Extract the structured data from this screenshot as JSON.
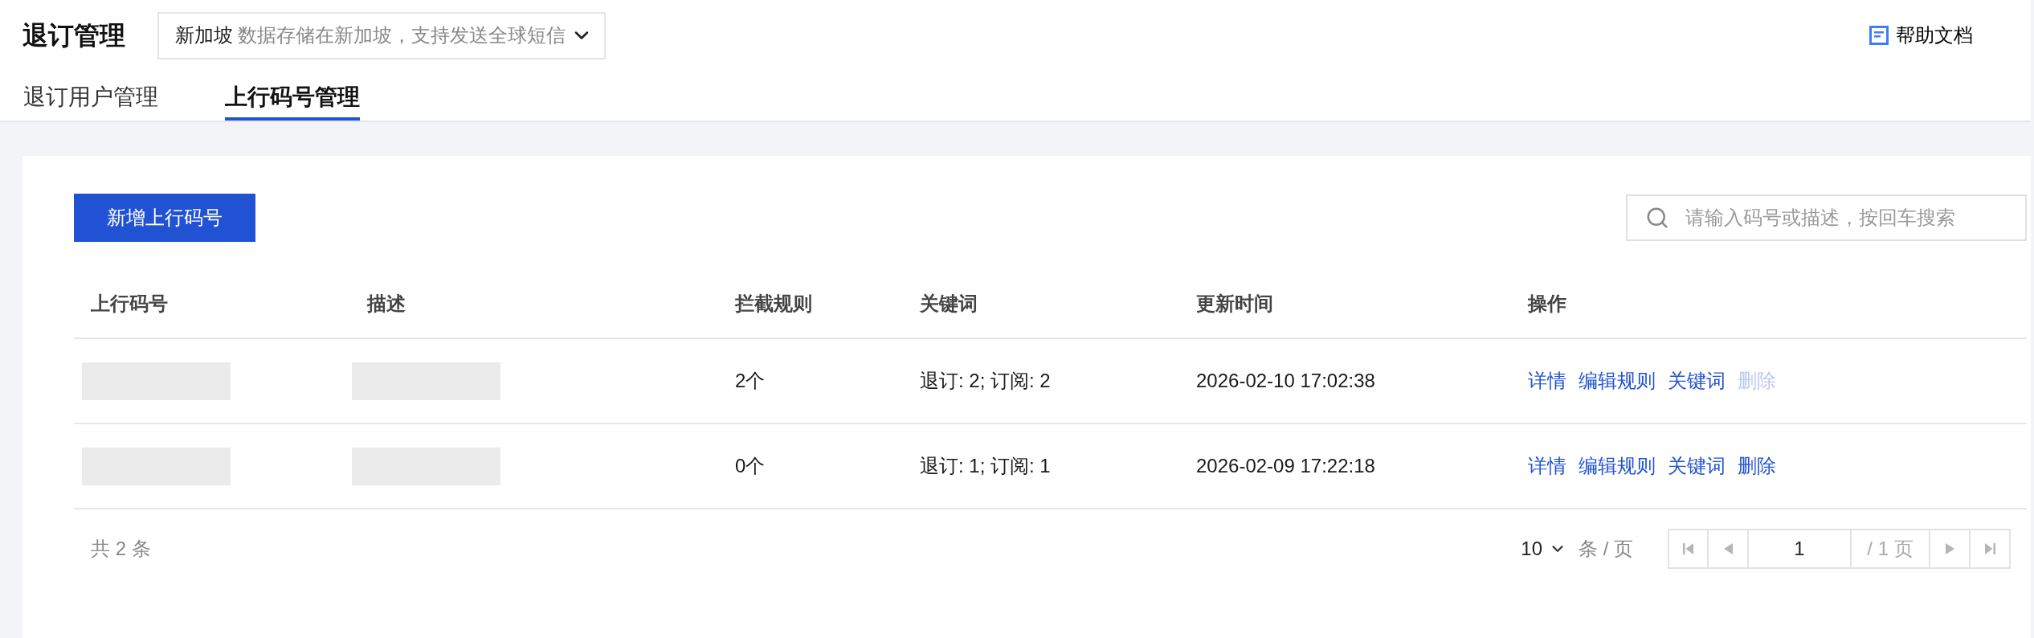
{
  "header": {
    "title": "退订管理",
    "region": {
      "name": "新加坡",
      "note": "数据存储在新加坡，支持发送全球短信"
    },
    "help_link": "帮助文档"
  },
  "tabs": [
    {
      "label": "退订用户管理",
      "selected": false
    },
    {
      "label": "上行码号管理",
      "selected": true
    }
  ],
  "toolbar": {
    "add_button": "新增上行码号",
    "search": {
      "placeholder": "请输入码号或描述，按回车搜索"
    }
  },
  "table": {
    "columns": [
      "上行码号",
      "描述",
      "拦截规则",
      "关键词",
      "更新时间",
      "操作"
    ],
    "rows": [
      {
        "code_redacted": true,
        "description_redacted": true,
        "rules": "2个",
        "keywords": "退订: 2; 订阅: 2",
        "updated": "2026-02-10 17:02:38",
        "actions": [
          {
            "label": "详情",
            "disabled": false
          },
          {
            "label": "编辑规则",
            "disabled": false
          },
          {
            "label": "关键词",
            "disabled": false
          },
          {
            "label": "删除",
            "disabled": true
          }
        ]
      },
      {
        "code_redacted": true,
        "description_redacted": true,
        "rules": "0个",
        "keywords": "退订: 1; 订阅: 1",
        "updated": "2026-02-09 17:22:18",
        "actions": [
          {
            "label": "详情",
            "disabled": false
          },
          {
            "label": "编辑规则",
            "disabled": false
          },
          {
            "label": "关键词",
            "disabled": false
          },
          {
            "label": "删除",
            "disabled": false
          }
        ]
      }
    ]
  },
  "footer": {
    "total": "共 2 条",
    "page_size": "10",
    "page_size_unit": "条 / 页",
    "page": "1",
    "page_total": "/ 1 页",
    "pager_nav": [
      {
        "kind": "first",
        "disabled": true
      },
      {
        "kind": "prev",
        "disabled": true
      },
      {
        "kind": "next",
        "disabled": true
      },
      {
        "kind": "last",
        "disabled": true
      }
    ]
  }
}
